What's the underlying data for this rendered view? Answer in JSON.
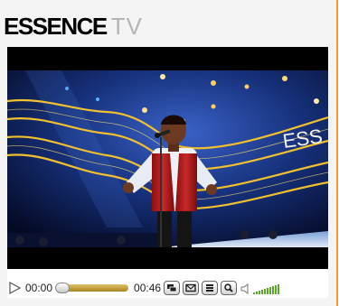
{
  "logo": {
    "brand": "ESSENCE",
    "suffix": "TV"
  },
  "video": {
    "stage_text": "ESS"
  },
  "player": {
    "current_time": "00:00",
    "duration": "00:46",
    "progress": 0,
    "volume_level": 1.0,
    "icons": [
      "play-icon",
      "embed-icon",
      "email-icon",
      "menu-icon",
      "search-icon",
      "speaker-icon"
    ]
  },
  "colors": {
    "accent": "#e0a040",
    "seek_fill": "#c8a640",
    "volume_bars": "#5aa82a"
  }
}
